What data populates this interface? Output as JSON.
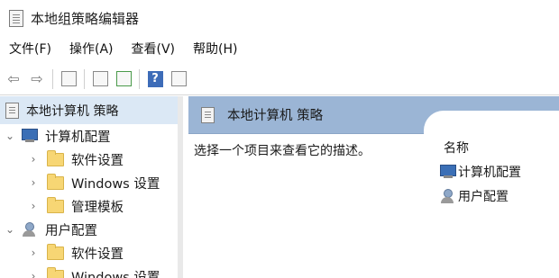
{
  "window": {
    "title": "本地组策略编辑器"
  },
  "menu": [
    {
      "label": "文件(F)"
    },
    {
      "label": "操作(A)"
    },
    {
      "label": "查看(V)"
    },
    {
      "label": "帮助(H)"
    }
  ],
  "toolbar": {
    "back_icon": "back-arrow-icon",
    "forward_icon": "forward-arrow-icon",
    "help_label": "?"
  },
  "tree": {
    "root": "本地计算机 策略",
    "computer_config": "计算机配置",
    "computer_children": [
      "软件设置",
      "Windows 设置",
      "管理模板"
    ],
    "user_config": "用户配置",
    "user_children": [
      "软件设置",
      "Windows 设置"
    ]
  },
  "details": {
    "header": "本地计算机 策略",
    "description": "选择一个项目来查看它的描述。",
    "column_name": "名称",
    "items": [
      "计算机配置",
      "用户配置"
    ]
  },
  "colors": {
    "header_bg": "#9bb5d5",
    "selection_bg": "#dbe8f5",
    "folder": "#f7d674"
  }
}
